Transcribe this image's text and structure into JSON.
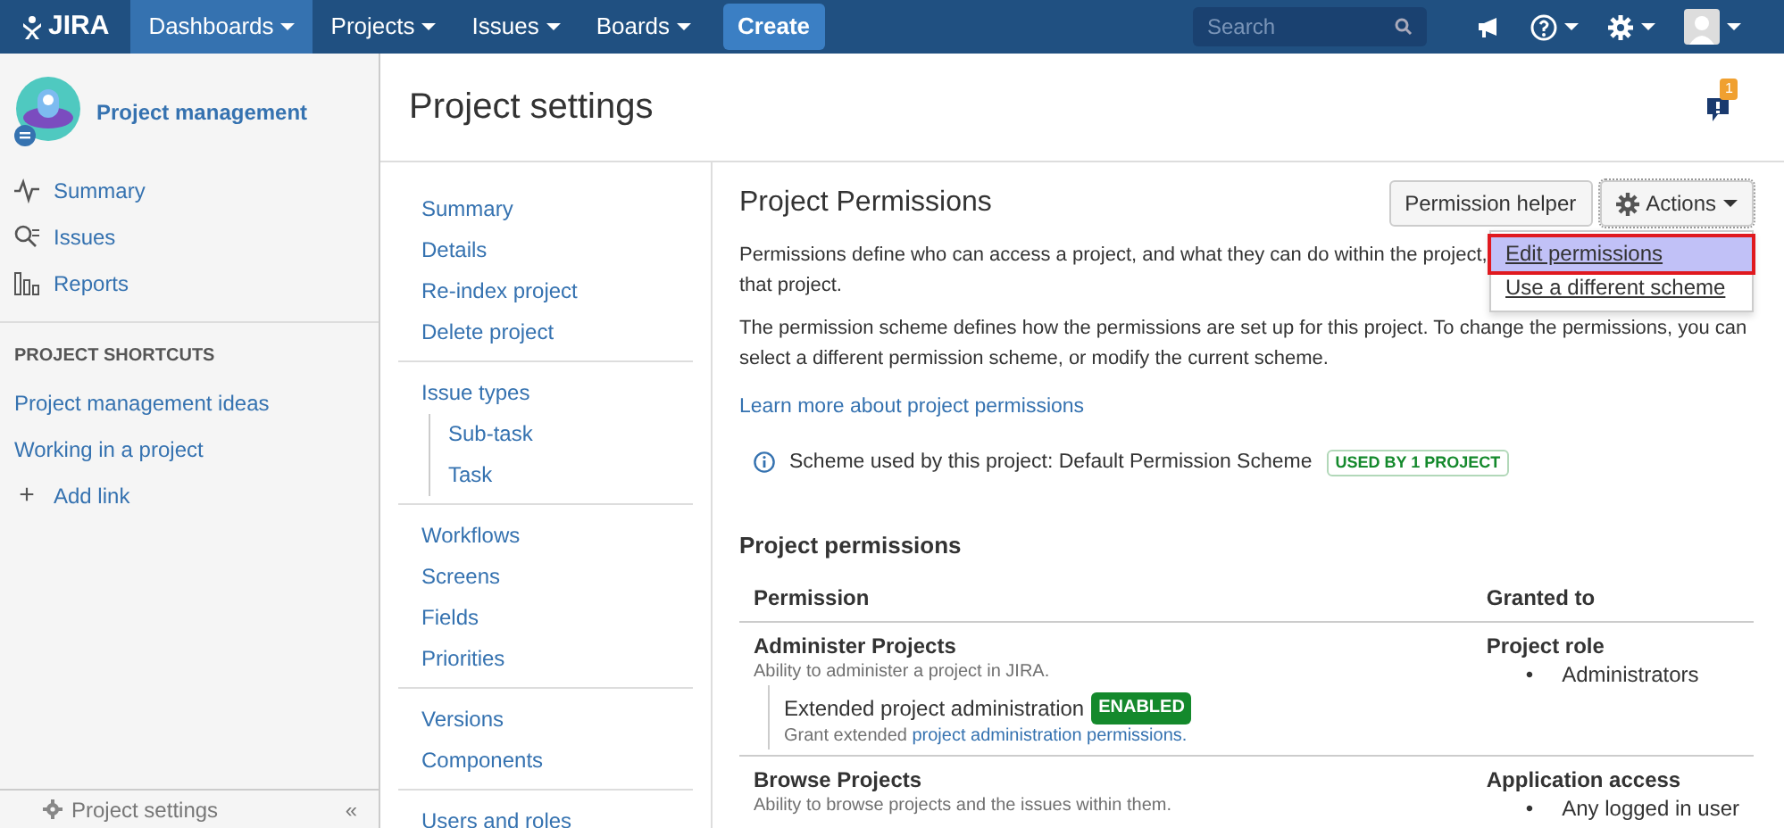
{
  "topbar": {
    "logo": "JIRA",
    "menus": [
      {
        "label": "Dashboards",
        "selected": true
      },
      {
        "label": "Projects",
        "selected": false
      },
      {
        "label": "Issues",
        "selected": false
      },
      {
        "label": "Boards",
        "selected": false
      }
    ],
    "create": "Create",
    "search": {
      "placeholder": "Search"
    }
  },
  "sidebar": {
    "project": "Project management",
    "items": [
      {
        "label": "Summary",
        "kind": "summary"
      },
      {
        "label": "Issues",
        "kind": "issues"
      },
      {
        "label": "Reports",
        "kind": "reports"
      }
    ],
    "shortcuts_heading": "PROJECT SHORTCUTS",
    "shortcuts": [
      "Project management ideas",
      "Working in a project"
    ],
    "add_link": {
      "icon": "+",
      "label": "Add link"
    },
    "footer": "Project settings",
    "collapse": "«"
  },
  "page_title": "Project settings",
  "notification_count": "1",
  "settings_nav": [
    [
      {
        "label": "Summary"
      },
      {
        "label": "Details"
      },
      {
        "label": "Re-index project"
      },
      {
        "label": "Delete project"
      }
    ],
    [
      {
        "label": "Issue types",
        "children": [
          {
            "label": "Sub-task"
          },
          {
            "label": "Task"
          }
        ]
      }
    ],
    [
      {
        "label": "Workflows"
      },
      {
        "label": "Screens"
      },
      {
        "label": "Fields"
      },
      {
        "label": "Priorities"
      }
    ],
    [
      {
        "label": "Versions"
      },
      {
        "label": "Components"
      }
    ],
    [
      {
        "label": "Users and roles"
      }
    ]
  ],
  "content": {
    "title": "Project Permissions",
    "helper": "Permission helper",
    "actions": "Actions",
    "actions_menu": [
      {
        "label": "Edit permissions",
        "selected": true
      },
      {
        "label": "Use a different scheme",
        "selected": false
      }
    ],
    "intro_lines": [
      "Permissions define who can access a project, and what they can do within the project,",
      "that project."
    ],
    "paragraph": "The permission scheme defines how the permissions are set up for this project. To change the permissions, you can select a different permission scheme, or modify the current scheme.",
    "learn_more": "Learn more about project permissions",
    "scheme": "Scheme used by this project: Default Permission Scheme",
    "scheme_badge": "USED BY 1 PROJECT",
    "section": "Project permissions",
    "columns": [
      "Permission",
      "Granted to"
    ],
    "rows": [
      {
        "name": "Administer Projects",
        "description": "Ability to administer a project in JIRA.",
        "extended": {
          "name": "Extended project administration",
          "badge": "ENABLED",
          "text": "Grant extended",
          "link": "project administration permissions."
        },
        "grant_type": "Project role",
        "marker": "•",
        "grantees": [
          "Administrators"
        ]
      },
      {
        "name": "Browse Projects",
        "description": "Ability to browse projects and the issues within them.",
        "grant_type": "Application access",
        "marker": "•",
        "grantees": [
          "Any logged in user"
        ]
      }
    ]
  }
}
